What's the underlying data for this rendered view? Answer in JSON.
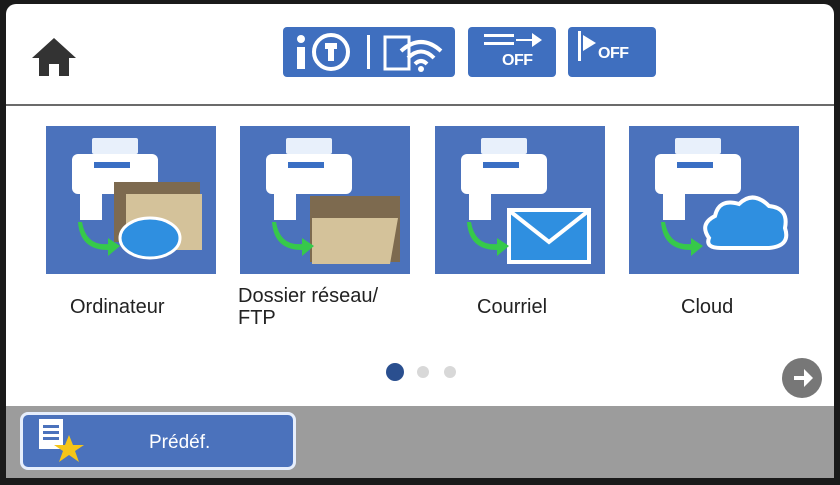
{
  "header": {
    "home_icon": "home-icon",
    "status_buttons": [
      {
        "name": "connectivity-status",
        "icons": [
          "info-network-icon",
          "wifi-icon"
        ]
      },
      {
        "name": "fax-transmission-off",
        "label": "OFF",
        "icon": "transmit-arrow-icon"
      },
      {
        "name": "auto-receive-off",
        "label": "OFF",
        "icon": "receive-icon"
      }
    ]
  },
  "destinations": [
    {
      "label": "Ordinateur",
      "icon": "printer-to-folder-and-cloud-icon"
    },
    {
      "label": "Dossier réseau/\nFTP",
      "icon": "printer-to-folder-icon"
    },
    {
      "label": "Courriel",
      "icon": "printer-to-email-icon"
    },
    {
      "label": "Cloud",
      "icon": "printer-to-cloud-icon"
    }
  ],
  "pagination": {
    "total": 3,
    "current": 1
  },
  "bottom": {
    "preset_label": "Prédéf.",
    "preset_icon": "document-star-icon"
  },
  "colors": {
    "accent": "#4b72bc",
    "bottom_bar": "#9c9c9c",
    "page_dot_active": "#2a4f8f"
  }
}
